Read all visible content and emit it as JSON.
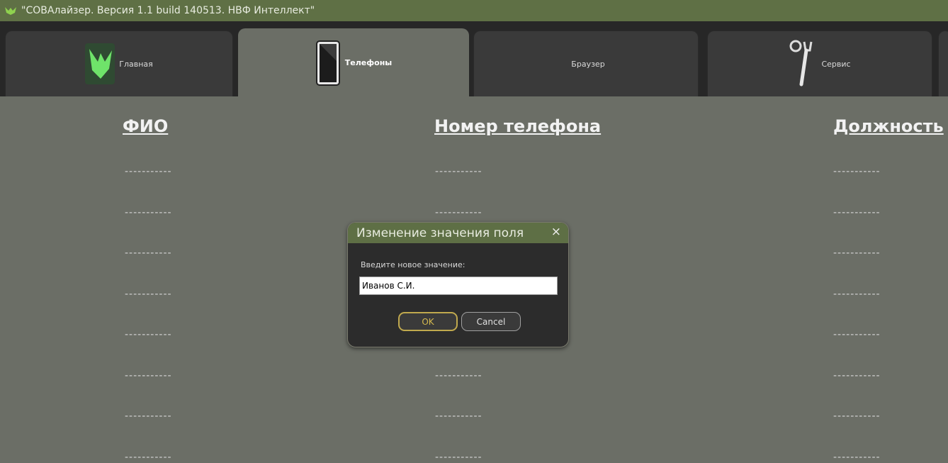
{
  "window": {
    "title": "\"СОВАлайзер. Версия 1.1 build 140513. НВФ Интеллект\""
  },
  "tabs": [
    {
      "label": "Главная",
      "icon": "bird-icon",
      "active": false
    },
    {
      "label": "Телефоны",
      "icon": "phone-icon",
      "active": true
    },
    {
      "label": "Браузер",
      "icon": "",
      "active": false
    },
    {
      "label": "Сервис",
      "icon": "tools-icon",
      "active": false
    }
  ],
  "table": {
    "headers": [
      "ФИО",
      "Номер телефона",
      "Должность"
    ],
    "rows": [
      [
        "-----------",
        "-----------",
        "-----------"
      ],
      [
        "-----------",
        "-----------",
        "-----------"
      ],
      [
        "-----------",
        "",
        "-----------"
      ],
      [
        "-----------",
        "",
        "-----------"
      ],
      [
        "-----------",
        "",
        "-----------"
      ],
      [
        "-----------",
        "-----------",
        "-----------"
      ],
      [
        "-----------",
        "-----------",
        "-----------"
      ],
      [
        "-----------",
        "-----------",
        "-----------"
      ]
    ]
  },
  "dialog": {
    "title": "Изменение значения поля",
    "close": "×",
    "prompt": "Введите новое значение:",
    "input_value": "Иванов С.И.",
    "ok_label": "OK",
    "cancel_label": "Cancel"
  },
  "colors": {
    "accent_green": "#5f7045",
    "background": "#6b6e66",
    "ok_border": "#c0a94e"
  }
}
